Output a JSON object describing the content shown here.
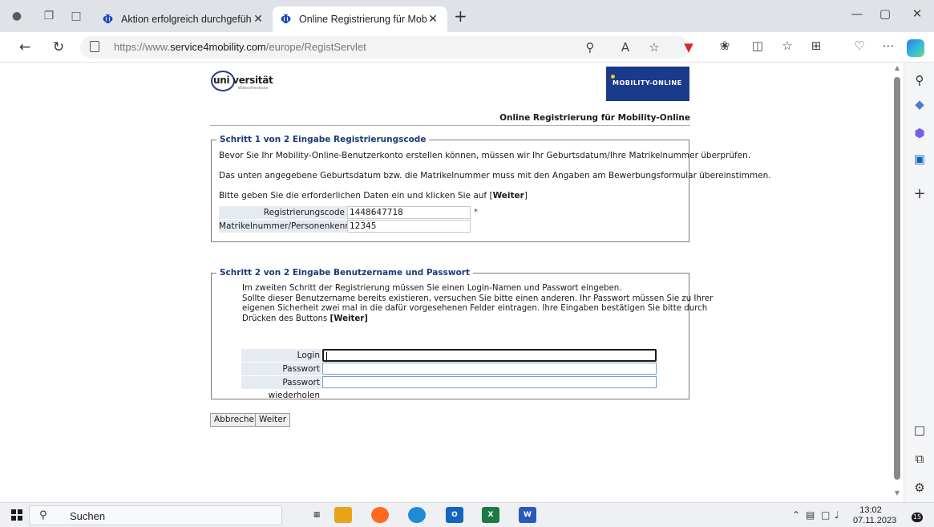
{
  "browser": {
    "tabs": [
      {
        "title": "Aktion erfolgreich durchgeführt!",
        "favicon": "Φ",
        "active": false
      },
      {
        "title": "Online Registrierung für Mobility",
        "favicon": "Φ",
        "active": true
      }
    ],
    "new_tab": "+",
    "window_controls": {
      "minimize": "—",
      "maximize": "▢",
      "close": "✕"
    },
    "url_prefix": "https://www.",
    "url_host": "service4mobility.com",
    "url_path": "/europe/RegistServlet"
  },
  "page": {
    "logo_left_word": "uni versität",
    "logo_left_sub": "Witten/Herdecke",
    "logo_right": "MOBILITY-ONLINE",
    "heading": "Online Registrierung für Mobility-Online",
    "step1": {
      "legend": "Schritt 1 von 2 Eingabe Registrierungscode",
      "para1": "Bevor Sie Ihr Mobility-Online-Benutzerkonto erstellen können, müssen wir Ihr Geburtsdatum/Ihre Matrikelnummer überprüfen.",
      "para2": "Das unten angegebene Geburtsdatum bzw. die Matrikelnummer muss mit den Angaben am Bewerbungsformular übereinstimmen.",
      "para3_prefix": "Bitte geben Sie die erforderlichen Daten ein und klicken Sie auf [",
      "para3_bold": "Weiter",
      "para3_suffix": "]",
      "rows": [
        {
          "label": "Registrierungscode",
          "value": "1448647718",
          "required": "*"
        },
        {
          "label": "Matrikelnummer/Personenkennzeichen",
          "value": "12345"
        }
      ]
    },
    "step2": {
      "legend": "Schritt 2 von 2 Eingabe Benutzername und Passwort",
      "line1": "Im zweiten Schritt der Registrierung müssen Sie einen Login-Namen und Passwort eingeben.",
      "line2": "Sollte dieser Benutzername bereits existieren, versuchen Sie bitte einen anderen. Ihr Passwort müssen Sie zu Ihrer",
      "line3": "eigenen Sicherheit zwei mal in die dafür vorgesehenen Felder eintragen. Ihre Eingaben bestätigen Sie bitte durch",
      "line4_prefix": "Drücken des Buttons ",
      "line4_bold": "[Weiter]",
      "fields": [
        {
          "label": "Login",
          "value": ""
        },
        {
          "label": "Passwort",
          "value": ""
        },
        {
          "label": "Passwort wiederholen",
          "value": ""
        }
      ]
    },
    "buttons": {
      "cancel": "Abbrechen",
      "next": "Weiter"
    }
  },
  "taskbar": {
    "search_placeholder": "Suchen",
    "time": "13:02",
    "date": "07.11.2023",
    "notifications": "15"
  },
  "colors": {
    "legend_blue": "#1b3a7a",
    "label_bg": "#e6ebf2",
    "input_border": "#6f9cd4",
    "mobility_blue": "#1a3a8c"
  }
}
